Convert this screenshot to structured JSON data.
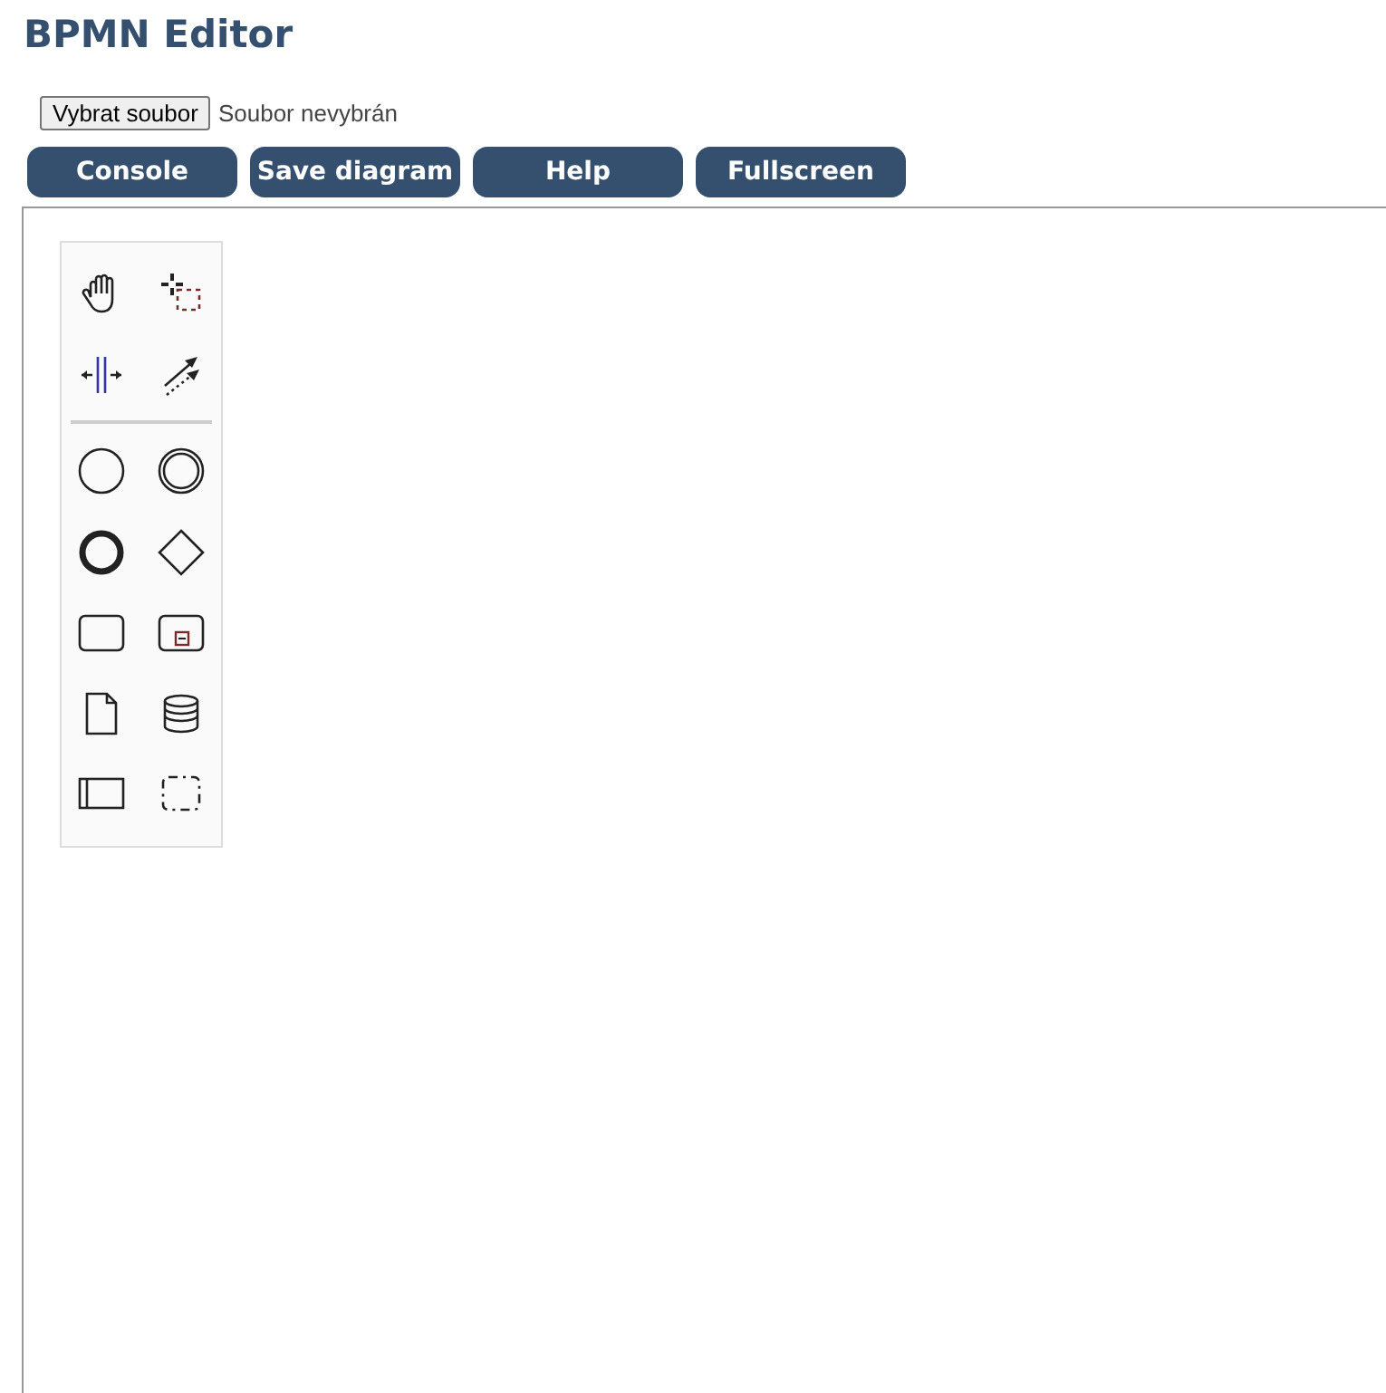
{
  "title": "BPMN Editor",
  "file_input": {
    "button": "Vybrat soubor",
    "status": "Soubor nevybrán"
  },
  "buttons": [
    "Console",
    "Save diagram",
    "Help",
    "Fullscreen"
  ]
}
